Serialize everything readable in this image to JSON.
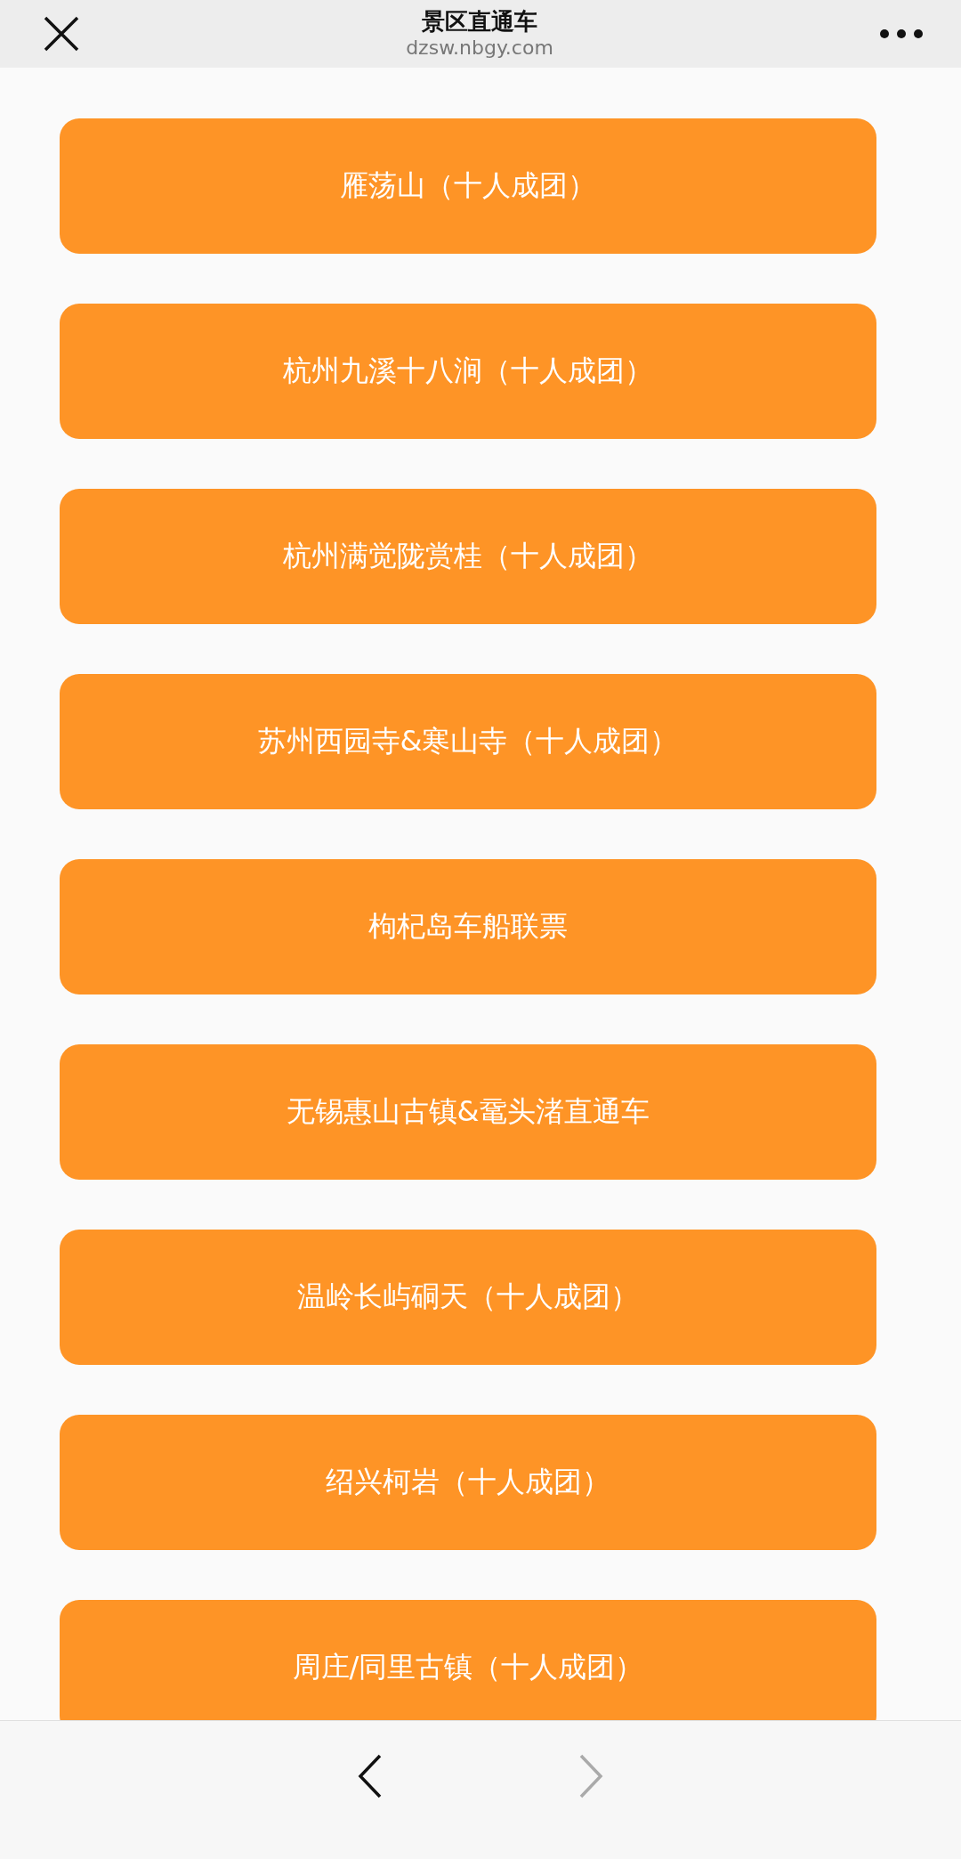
{
  "header": {
    "title": "景区直通车",
    "url": "dzsw.nbgy.com"
  },
  "routes": [
    {
      "label": "雁荡山（十人成团）"
    },
    {
      "label": "杭州九溪十八涧（十人成团）"
    },
    {
      "label": "杭州满觉陇赏桂（十人成团）"
    },
    {
      "label": "苏州西园寺&寒山寺（十人成团）"
    },
    {
      "label": "枸杞岛车船联票"
    },
    {
      "label": "无锡惠山古镇&鼋头渚直通车"
    },
    {
      "label": "温岭长屿硐天（十人成团）"
    },
    {
      "label": "绍兴柯岩（十人成团）"
    },
    {
      "label": "周庄/同里古镇（十人成团）"
    }
  ],
  "nav": {
    "back": {
      "disabled": false
    },
    "forward": {
      "disabled": true
    }
  }
}
